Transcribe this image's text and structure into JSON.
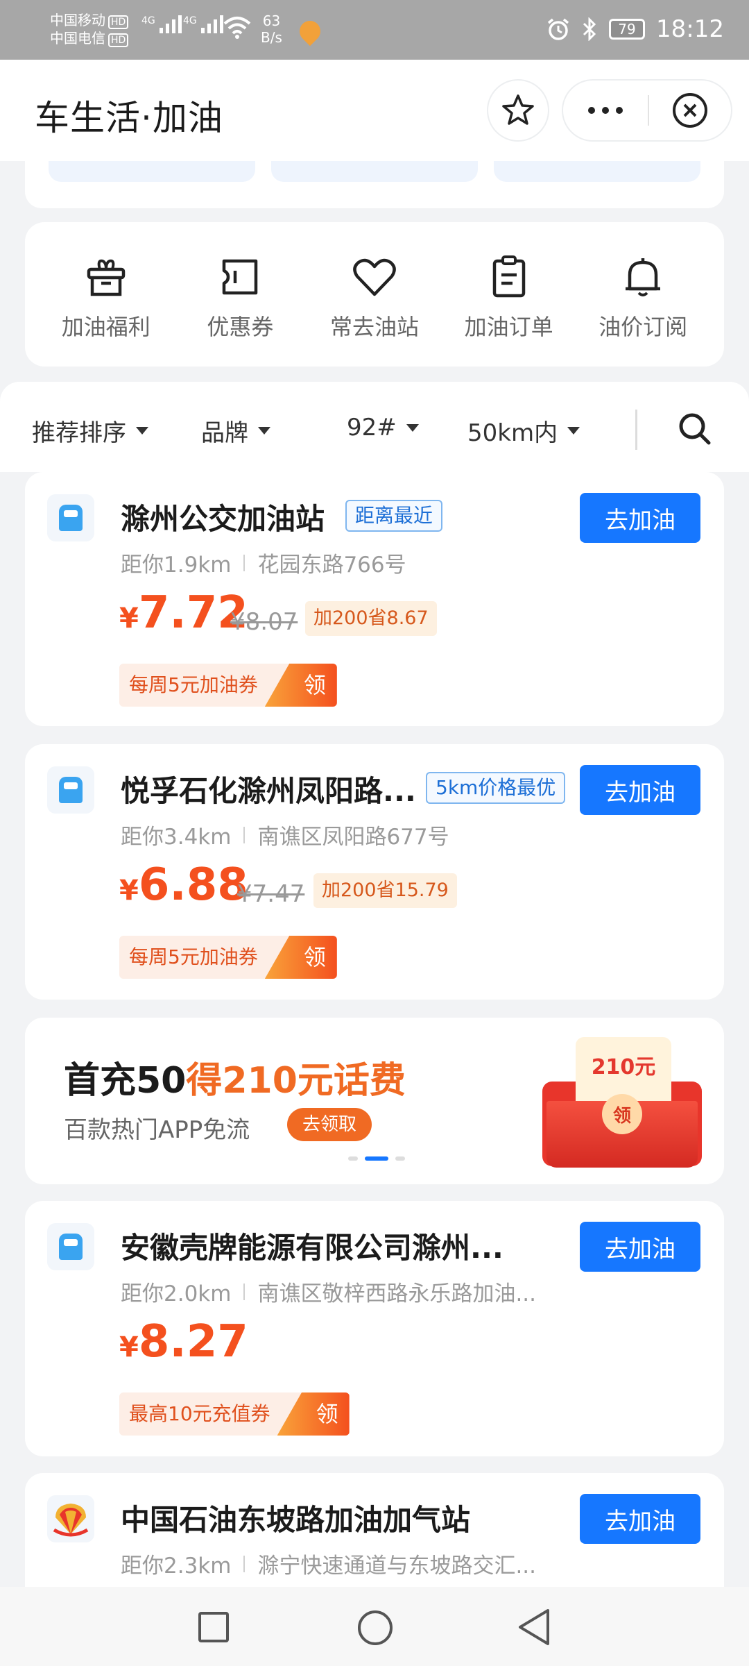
{
  "status_bar": {
    "carrier1": "中国移动",
    "carrier2": "中国电信",
    "hd": "HD",
    "net1": "4G",
    "net2": "4G",
    "speed_value": "63",
    "speed_unit": "B/s",
    "battery": "79",
    "time": "18:12"
  },
  "header": {
    "title": "车生活·加油"
  },
  "quick_entries": [
    {
      "label": "加油福利",
      "icon": "gift-icon"
    },
    {
      "label": "优惠券",
      "icon": "ticket-icon"
    },
    {
      "label": "常去油站",
      "icon": "heart-icon"
    },
    {
      "label": "加油订单",
      "icon": "clipboard-icon"
    },
    {
      "label": "油价订阅",
      "icon": "bell-icon"
    }
  ],
  "filters": {
    "sort": "推荐排序",
    "brand": "品牌",
    "fuel": "92#",
    "distance": "50km内"
  },
  "stations": [
    {
      "name": "滁州公交加油站",
      "tag": "距离最近",
      "distance": "距你1.9km",
      "address": "花园东路766号",
      "yen": "¥",
      "price": "7.72",
      "original_price": "¥8.07",
      "saving": "加200省8.67",
      "coupon": "每周5元加油券",
      "coupon_action": "领",
      "button": "去加油"
    },
    {
      "name": "悦孚石化滁州凤阳路...",
      "tag": "5km价格最优",
      "distance": "距你3.4km",
      "address": "南谯区凤阳路677号",
      "yen": "¥",
      "price": "6.88",
      "original_price": "¥7.47",
      "saving": "加200省15.79",
      "coupon": "每周5元加油券",
      "coupon_action": "领",
      "button": "去加油"
    },
    {
      "name": "安徽壳牌能源有限公司滁州...",
      "distance": "距你2.0km",
      "address": "南谯区敬梓西路永乐路加油...",
      "yen": "¥",
      "price": "8.27",
      "coupon": "最高10元充值券",
      "coupon_action": "领",
      "button": "去加油"
    },
    {
      "name": "中国石油东坡路加油加气站",
      "distance": "距你2.3km",
      "address": "滁宁快速通道与东坡路交汇...",
      "button": "去加油"
    }
  ],
  "banner": {
    "title_part1": "首充50",
    "title_part2": "得210元话费",
    "subtitle": "百款热门APP免流",
    "button": "去领取",
    "envelope_amount": "210元",
    "envelope_seal": "领",
    "active_slide": 2,
    "slide_count": 3
  },
  "colors": {
    "accent_blue": "#1677ff",
    "price_orange": "#f4501e",
    "status_bar_gray": "#a7a7a7"
  }
}
